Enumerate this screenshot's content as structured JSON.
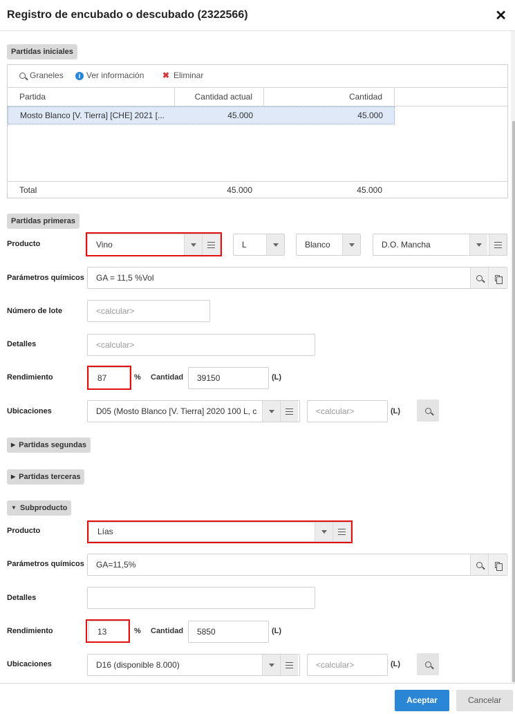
{
  "dialog": {
    "title": "Registro de encubado o descubado (2322566)"
  },
  "initial_lots": {
    "section_label": "Partidas iniciales",
    "toolbar": {
      "granels": "Graneles",
      "info": "Ver información",
      "delete": "Eliminar"
    },
    "columns": [
      "Partida",
      "Cantidad actual",
      "Cantidad"
    ],
    "rows": [
      {
        "partida": "Mosto Blanco [V. Tierra] [CHE] 2021 [...",
        "cantidad_actual": "45.000",
        "cantidad": "45.000"
      }
    ],
    "total": {
      "label": "Total",
      "cantidad_actual": "45.000",
      "cantidad": "45.000"
    }
  },
  "first_lots": {
    "section_label": "Partidas primeras",
    "producto_label": "Producto",
    "producto": "Vino",
    "unit_select": "L",
    "color_select": "Blanco",
    "do_select": "D.O. Mancha",
    "chem_label": "Parámetros químicos",
    "chem_value": "GA = 11,5 %Vol",
    "lote_label": "Número de lote",
    "lote_placeholder": "<calcular>",
    "detalles_label": "Detalles",
    "detalles_placeholder": "<calcular>",
    "rend_label": "Rendimiento",
    "rend_value": "87",
    "percent": "%",
    "cantidad_label": "Cantidad",
    "cantidad_value": "39150",
    "unit_l": "(L)",
    "ubic_label": "Ubicaciones",
    "ubic_value": "D05 (Mosto Blanco [V. Tierra] 2020 100 L, c",
    "ubic_qty_placeholder": "<calcular>",
    "ubic_unit": "(L)"
  },
  "second_lots": {
    "section_label": "Partidas segundas"
  },
  "third_lots": {
    "section_label": "Partidas terceras"
  },
  "byproduct": {
    "section_label": "Subproducto",
    "producto_label": "Producto",
    "producto": "Lías",
    "chem_label": "Parámetros químicos",
    "chem_value": "GA=11,5%",
    "detalles_label": "Detalles",
    "detalles_value": "",
    "rend_label": "Rendimiento",
    "rend_value": "13",
    "percent": "%",
    "cantidad_label": "Cantidad",
    "cantidad_value": "5850",
    "unit_l": "(L)",
    "ubic_label": "Ubicaciones",
    "ubic_value": "D16 (disponible 8.000)",
    "ubic_qty_placeholder": "<calcular>",
    "ubic_unit": "(L)"
  },
  "footer": {
    "accept": "Aceptar",
    "cancel": "Cancelar"
  },
  "colors": {
    "primary": "#2b86d6",
    "highlight_outline": "#e01010",
    "delete_icon": "#d9363e",
    "info_icon": "#2b86d6"
  },
  "icons": [
    "close-icon",
    "search-icon",
    "info-icon",
    "delete-icon",
    "caret-down-icon",
    "menu-icon",
    "copy-icon",
    "triangle-right-icon",
    "triangle-down-icon"
  ]
}
